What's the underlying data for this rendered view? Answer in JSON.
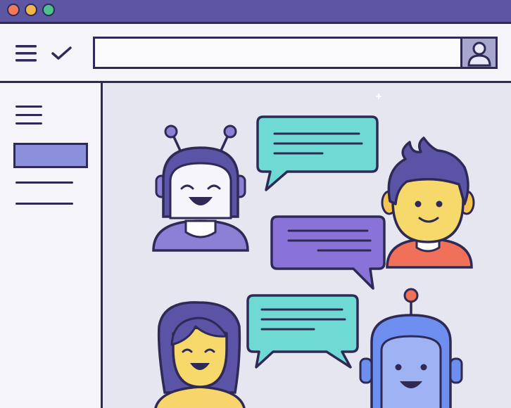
{
  "window": {
    "controls": [
      {
        "name": "close",
        "color": "#f07a5a"
      },
      {
        "name": "minimize",
        "color": "#f2b64a"
      },
      {
        "name": "maximize",
        "color": "#4cc38a"
      }
    ]
  },
  "toolbar": {
    "menu_icon": "hamburger-menu-icon",
    "check_icon": "checkmark-icon",
    "search": {
      "value": "",
      "placeholder": ""
    },
    "profile_icon": "user-profile-icon"
  },
  "sidebar": {
    "menu_icon": "hamburger-menu-icon",
    "items": [
      {
        "label": "",
        "selected": true
      },
      {
        "label": "",
        "selected": false
      },
      {
        "label": "",
        "selected": false
      }
    ]
  },
  "chat_scene": {
    "participants": [
      {
        "name": "robot-left",
        "kind": "robot",
        "shirt_color": "#8b7fd6"
      },
      {
        "name": "spiky-hair-boy",
        "kind": "person",
        "shirt_color": "#f0705a"
      },
      {
        "name": "long-hair-girl",
        "kind": "person",
        "shirt_color": "#f7d56a"
      },
      {
        "name": "blue-robot",
        "kind": "robot",
        "head_color": "#6f8ff0"
      }
    ],
    "bubbles": [
      {
        "name": "teal-bubble-top",
        "color": "#6fdad3"
      },
      {
        "name": "purple-bubble-middle",
        "color": "#8a73d8"
      },
      {
        "name": "teal-bubble-bottom",
        "color": "#6fdad3"
      }
    ]
  }
}
